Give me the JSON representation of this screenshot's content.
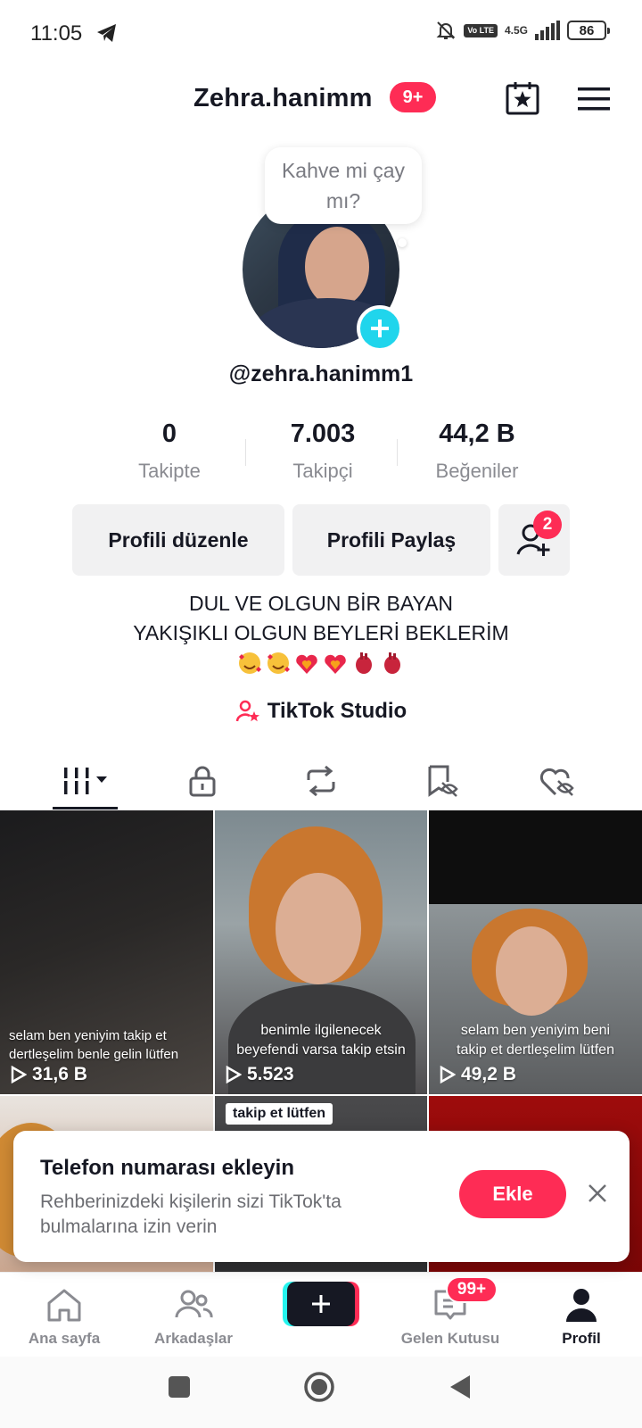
{
  "status_bar": {
    "time": "11:05",
    "network": "4.5G",
    "volte": "Vo LTE",
    "battery": "86"
  },
  "header": {
    "username": "Zehra.hanimm",
    "notification_badge": "9+"
  },
  "profile": {
    "bubble_text": "Kahve mi çay mı?",
    "handle": "@zehra.hanimm1"
  },
  "stats": {
    "following_count": "0",
    "following_label": "Takipte",
    "followers_count": "7.003",
    "followers_label": "Takipçi",
    "likes_count": "44,2 B",
    "likes_label": "Beğeniler"
  },
  "actions": {
    "edit_profile": "Profili düzenle",
    "share_profile": "Profili Paylaş",
    "friend_badge": "2"
  },
  "bio": {
    "line1": "DUL VE OLGUN BİR BAYAN",
    "line2": "YAKIŞIKLI OLGUN BEYLERİ BEKLERİM",
    "emojis": [
      "smiling-face-with-hearts",
      "smiling-face-with-hearts",
      "heart-on-fire",
      "heart-on-fire",
      "anatomical-heart",
      "anatomical-heart"
    ]
  },
  "studio": {
    "label": "TikTok Studio"
  },
  "tabs": [
    "videos-grid",
    "private",
    "reposts",
    "favorites",
    "liked"
  ],
  "videos": [
    {
      "caption": "selam ben yeniyim takip et dertleşelim benle gelin lütfen",
      "views": "31,6 B"
    },
    {
      "caption": "benimle ilgilenecek beyefendi varsa takip etsin",
      "views": "5.523"
    },
    {
      "caption": "selam ben yeniyim beni takip et dertleşelim lütfen",
      "views": "49,2 B"
    },
    {
      "caption": "",
      "views": ""
    },
    {
      "caption": "takip et lütfen",
      "views": ""
    },
    {
      "caption": "",
      "views": ""
    }
  ],
  "toast": {
    "title": "Telefon numarası ekleyin",
    "description": "Rehberinizdeki kişilerin sizi TikTok'ta bulmalarına izin verin",
    "button": "Ekle"
  },
  "bottom_nav": {
    "home": "Ana sayfa",
    "friends": "Arkadaşlar",
    "inbox": "Gelen Kutusu",
    "inbox_badge": "99+",
    "profile": "Profil"
  },
  "colors": {
    "accent": "#fe2c55",
    "cyan": "#20d5ec",
    "text": "#161823",
    "muted": "#8a8b91"
  }
}
